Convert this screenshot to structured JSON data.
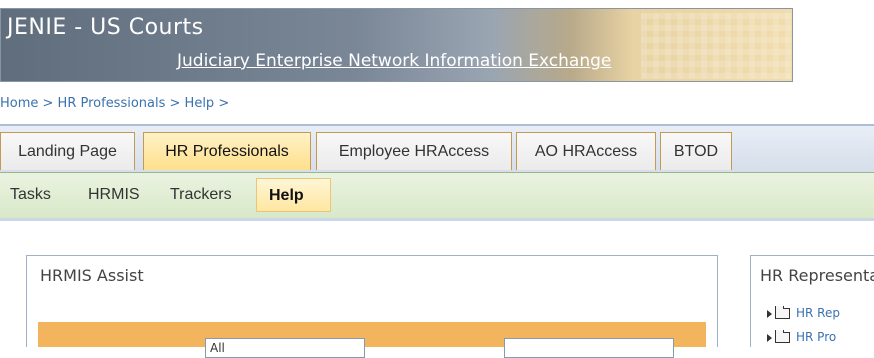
{
  "banner": {
    "title": "JENIE - US Courts",
    "subtitle": "Judiciary Enterprise Network Information Exchange"
  },
  "breadcrumb": "Home > HR Professionals > Help >",
  "tabs": [
    {
      "label": "Landing Page",
      "active": false
    },
    {
      "label": "HR Professionals",
      "active": true
    },
    {
      "label": "Employee HRAccess",
      "active": false
    },
    {
      "label": "AO HRAccess",
      "active": false
    },
    {
      "label": "BTOD",
      "active": false
    }
  ],
  "subnav": [
    {
      "label": "Tasks",
      "active": false
    },
    {
      "label": "HRMIS",
      "active": false
    },
    {
      "label": "Trackers",
      "active": false
    },
    {
      "label": "Help",
      "active": true
    }
  ],
  "main_panel": {
    "title": "HRMIS Assist",
    "select_value": "All"
  },
  "right_panel": {
    "title": "HR Representatives",
    "items": [
      "HR Rep",
      "HR Pro"
    ]
  },
  "colors": {
    "accent_tab": "#ffe08a",
    "panel_strip": "#f2b45c",
    "link": "#3a72b0"
  }
}
